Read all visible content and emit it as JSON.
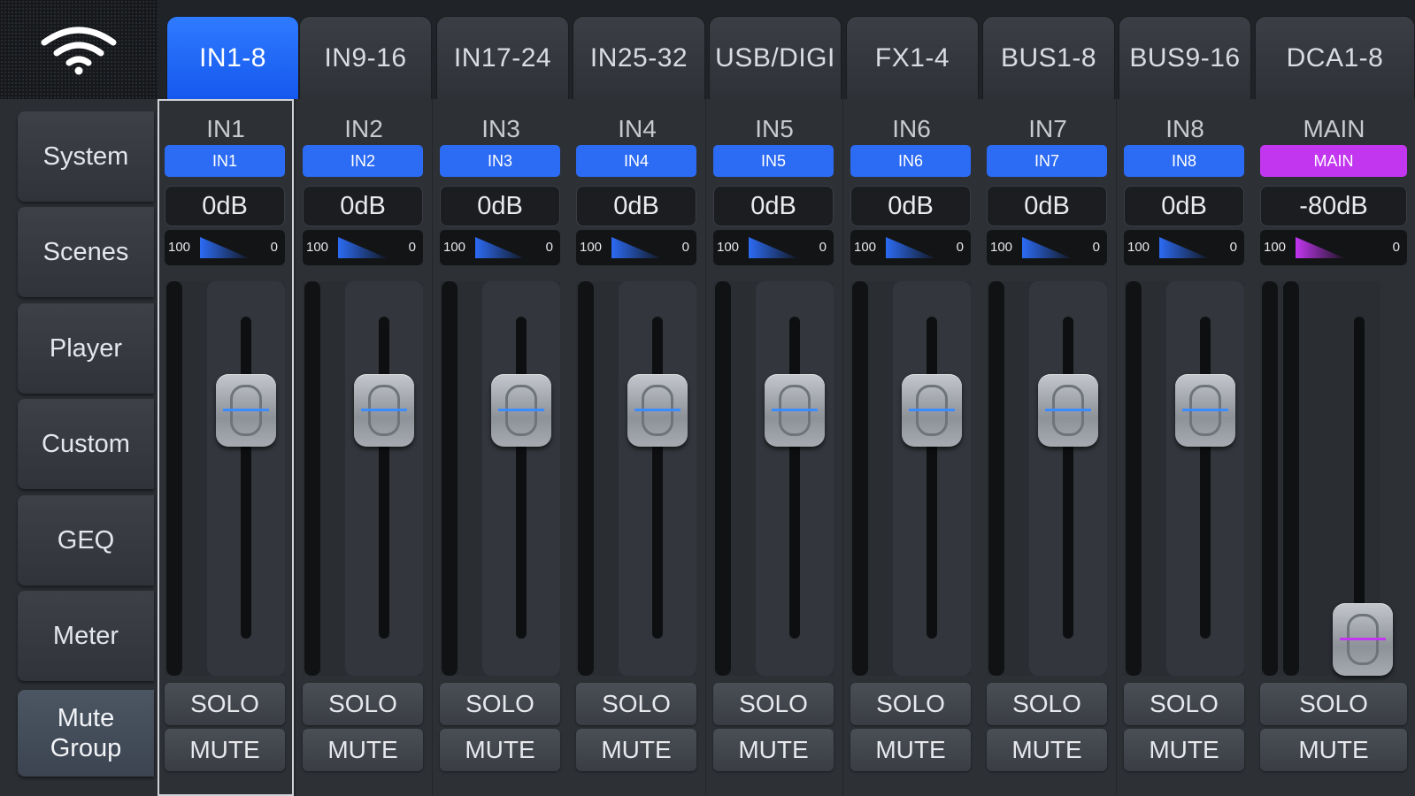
{
  "tabs": [
    {
      "label": "IN1-8",
      "active": true
    },
    {
      "label": "IN9-16",
      "active": false
    },
    {
      "label": "IN17-24",
      "active": false
    },
    {
      "label": "IN25-32",
      "active": false
    },
    {
      "label": "USB/DIGI",
      "active": false
    },
    {
      "label": "FX1-4",
      "active": false
    },
    {
      "label": "BUS1-8",
      "active": false
    },
    {
      "label": "BUS9-16",
      "active": false
    },
    {
      "label": "DCA1-8",
      "active": false
    }
  ],
  "sidebar": {
    "items": [
      {
        "label": "System"
      },
      {
        "label": "Scenes"
      },
      {
        "label": "Player"
      },
      {
        "label": "Custom"
      },
      {
        "label": "GEQ"
      },
      {
        "label": "Meter"
      },
      {
        "label": "Mute\nGroup",
        "active": true
      }
    ]
  },
  "pan_labels": {
    "left": "100",
    "right": "0"
  },
  "channels": [
    {
      "title": "IN1",
      "tag": "IN1",
      "gain": "0dB",
      "solo": "SOLO",
      "mute": "MUTE",
      "fader_level": 0.8,
      "selected": true
    },
    {
      "title": "IN2",
      "tag": "IN2",
      "gain": "0dB",
      "solo": "SOLO",
      "mute": "MUTE",
      "fader_level": 0.8
    },
    {
      "title": "IN3",
      "tag": "IN3",
      "gain": "0dB",
      "solo": "SOLO",
      "mute": "MUTE",
      "fader_level": 0.8
    },
    {
      "title": "IN4",
      "tag": "IN4",
      "gain": "0dB",
      "solo": "SOLO",
      "mute": "MUTE",
      "fader_level": 0.8
    },
    {
      "title": "IN5",
      "tag": "IN5",
      "gain": "0dB",
      "solo": "SOLO",
      "mute": "MUTE",
      "fader_level": 0.8
    },
    {
      "title": "IN6",
      "tag": "IN6",
      "gain": "0dB",
      "solo": "SOLO",
      "mute": "MUTE",
      "fader_level": 0.8
    },
    {
      "title": "IN7",
      "tag": "IN7",
      "gain": "0dB",
      "solo": "SOLO",
      "mute": "MUTE",
      "fader_level": 0.8
    },
    {
      "title": "IN8",
      "tag": "IN8",
      "gain": "0dB",
      "solo": "SOLO",
      "mute": "MUTE",
      "fader_level": 0.8
    },
    {
      "title": "MAIN",
      "tag": "MAIN",
      "gain": "-80dB",
      "solo": "SOLO",
      "mute": "MUTE",
      "fader_level": 0.0,
      "main": true
    }
  ],
  "colors": {
    "accent_blue": "#2c6bf4",
    "main_purple": "#c236f0"
  },
  "icons": {
    "status": "wifi-icon"
  }
}
